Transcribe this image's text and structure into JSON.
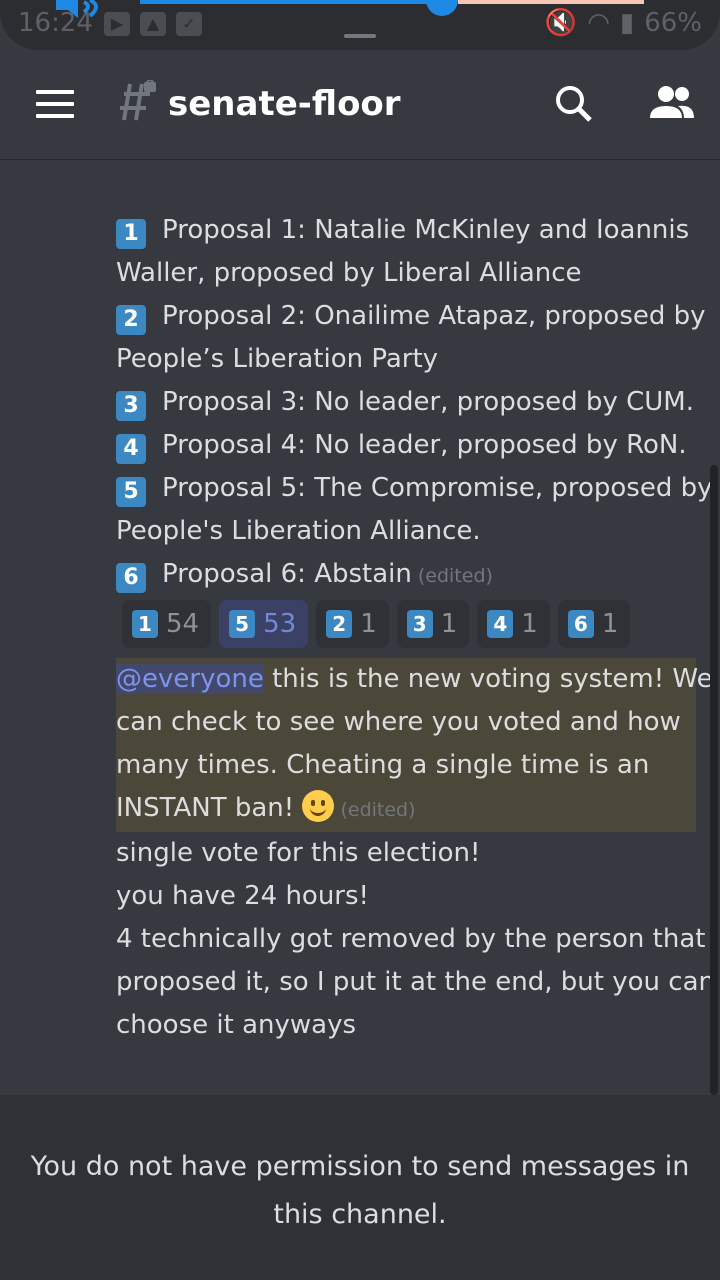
{
  "status_bar": {
    "time": "16:24",
    "battery": "66%"
  },
  "header": {
    "channel_name": "senate-floor"
  },
  "messages": {
    "proposals": [
      {
        "key": "1",
        "line1": "Proposal 1: Natalie McKinley and Ioannis",
        "line2": "Waller, proposed by Liberal Alliance"
      },
      {
        "key": "2",
        "line1": "Proposal 2: Onailime Atapaz, proposed by",
        "line2": "People’s Liberation Party"
      },
      {
        "key": "3",
        "line1": "Proposal 3: No leader, proposed by CUM.",
        "line2": ""
      },
      {
        "key": "4",
        "line1": "Proposal 4: No leader, proposed by RoN.",
        "line2": ""
      },
      {
        "key": "5",
        "line1": "Proposal 5: The Compromise, proposed by",
        "line2": "People's Liberation Alliance."
      },
      {
        "key": "6",
        "line1": "Proposal 6: Abstain",
        "line2": ""
      }
    ],
    "edited_label": "(edited)",
    "reactions": [
      {
        "key": "1",
        "count": "54"
      },
      {
        "key": "5",
        "count": "53"
      },
      {
        "key": "2",
        "count": "1"
      },
      {
        "key": "3",
        "count": "1"
      },
      {
        "key": "4",
        "count": "1"
      },
      {
        "key": "6",
        "count": "1"
      }
    ],
    "mention": "@everyone",
    "announcement_lines": [
      " this is the new voting system! We",
      "can check to see where you voted and how",
      "many times. Cheating a single time is an",
      "INSTANT ban! "
    ],
    "followups": [
      "single vote for this election!",
      "you have 24 hours!",
      "4 technically got removed by the person that",
      "proposed it, so I put it at the end, but you can",
      "choose it anyways"
    ]
  },
  "footer": {
    "line1": "You do not have permission to send messages in",
    "line2": "this channel."
  },
  "colors": {
    "background": "#36393f",
    "accent": "#7289da",
    "keycap": "#3b88c3",
    "mention_highlight": "#4b4739"
  }
}
